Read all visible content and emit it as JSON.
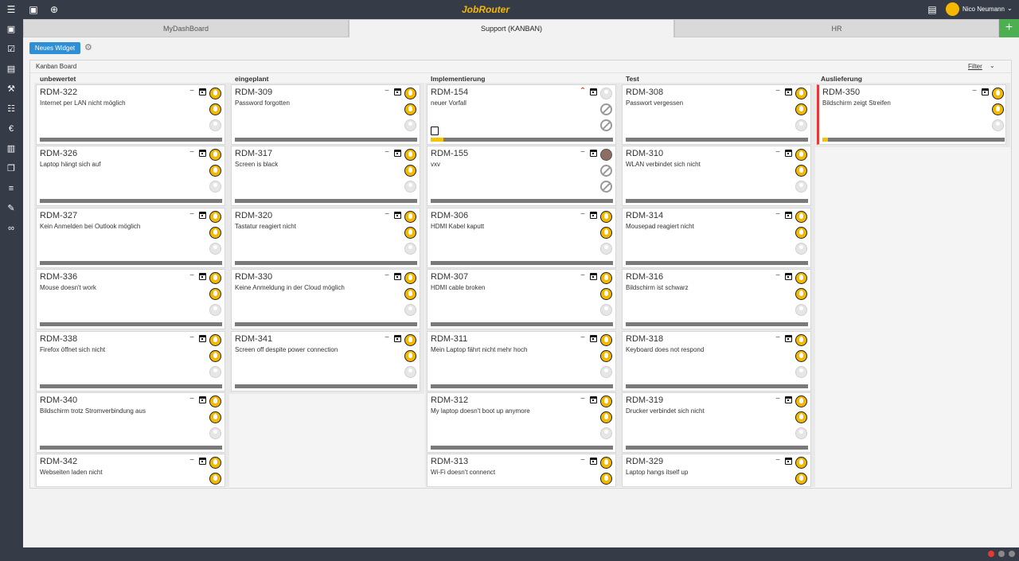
{
  "app": {
    "logo": "JobRouter",
    "user_name": "Nico Neumann"
  },
  "tabs": [
    {
      "label": "MyDashBoard",
      "active": false
    },
    {
      "label": "Support (KANBAN)",
      "active": true
    },
    {
      "label": "HR",
      "active": false
    }
  ],
  "toolbar": {
    "new_widget_label": "Neues Widget"
  },
  "board": {
    "title": "Kanban Board",
    "filter_label": "Filter"
  },
  "colors": {
    "chrome": "#363b48",
    "accent_yellow": "#f5b800",
    "button_blue": "#2f8fd6",
    "add_green": "#4caf50",
    "flag_red": "#e53935"
  },
  "columns": [
    {
      "title": "unbewertet",
      "cards": [
        {
          "id": "RDM-322",
          "desc": "Internet per LAN nicht möglich",
          "priority": "normal",
          "avatars": [
            "user",
            "user",
            "empty"
          ],
          "progress": 0
        },
        {
          "id": "RDM-326",
          "desc": "Laptop hängt sich auf",
          "priority": "normal",
          "avatars": [
            "user",
            "user",
            "empty"
          ],
          "progress": 0
        },
        {
          "id": "RDM-327",
          "desc": "Kein Anmelden bei Outlook möglich",
          "priority": "normal",
          "avatars": [
            "user",
            "user",
            "empty"
          ],
          "progress": 0
        },
        {
          "id": "RDM-336",
          "desc": "Mouse doesn't work",
          "priority": "normal",
          "avatars": [
            "user",
            "user",
            "empty"
          ],
          "progress": 0
        },
        {
          "id": "RDM-338",
          "desc": "Firefox öffnet sich nicht",
          "priority": "normal",
          "avatars": [
            "user",
            "user",
            "empty"
          ],
          "progress": 0
        },
        {
          "id": "RDM-340",
          "desc": "Bildschirm trotz Stromverbindung aus",
          "priority": "normal",
          "avatars": [
            "user",
            "user",
            "empty"
          ],
          "progress": 0
        },
        {
          "id": "RDM-342",
          "desc": "Webseiten laden nicht",
          "priority": "normal",
          "avatars": [
            "user",
            "user"
          ],
          "progress": 0
        }
      ]
    },
    {
      "title": "eingeplant",
      "cards": [
        {
          "id": "RDM-309",
          "desc": "Password forgotten",
          "priority": "normal",
          "avatars": [
            "user",
            "user",
            "empty"
          ],
          "progress": 0
        },
        {
          "id": "RDM-317",
          "desc": "Screen is black",
          "priority": "normal",
          "avatars": [
            "user",
            "user",
            "empty"
          ],
          "progress": 0
        },
        {
          "id": "RDM-320",
          "desc": "Tastatur reagiert nicht",
          "priority": "normal",
          "avatars": [
            "user",
            "user",
            "empty"
          ],
          "progress": 0
        },
        {
          "id": "RDM-330",
          "desc": "Keine Anmeldung in der Cloud möglich",
          "priority": "normal",
          "avatars": [
            "user",
            "user",
            "empty"
          ],
          "progress": 0
        },
        {
          "id": "RDM-341",
          "desc": "Screen off despite power connection",
          "priority": "normal",
          "avatars": [
            "user",
            "user",
            "empty"
          ],
          "progress": 0
        }
      ]
    },
    {
      "title": "Implementierung",
      "cards": [
        {
          "id": "RDM-154",
          "desc": "neuer Vorfall",
          "priority": "high",
          "avatars": [
            "empty",
            "blocked",
            "blocked"
          ],
          "progress": 0.07,
          "has_document": true
        },
        {
          "id": "RDM-155",
          "desc": "vxv",
          "priority": "normal",
          "avatars": [
            "photo",
            "blocked",
            "blocked"
          ],
          "progress": 0
        },
        {
          "id": "RDM-306",
          "desc": "HDMI Kabel kaputt",
          "priority": "normal",
          "avatars": [
            "user",
            "user",
            "empty"
          ],
          "progress": 0
        },
        {
          "id": "RDM-307",
          "desc": "HDMI cable broken",
          "priority": "normal",
          "avatars": [
            "user",
            "user",
            "empty"
          ],
          "progress": 0
        },
        {
          "id": "RDM-311",
          "desc": "Mein Laptop fährt nicht mehr hoch",
          "priority": "normal",
          "avatars": [
            "user",
            "user",
            "empty"
          ],
          "progress": 0
        },
        {
          "id": "RDM-312",
          "desc": "My laptop doesn't boot up anymore",
          "priority": "normal",
          "avatars": [
            "user",
            "user",
            "empty"
          ],
          "progress": 0
        },
        {
          "id": "RDM-313",
          "desc": "Wi-Fi doesn't connenct",
          "priority": "normal",
          "avatars": [
            "user",
            "user"
          ],
          "progress": 0
        }
      ]
    },
    {
      "title": "Test",
      "cards": [
        {
          "id": "RDM-308",
          "desc": "Passwort vergessen",
          "priority": "normal",
          "avatars": [
            "user",
            "user",
            "empty"
          ],
          "progress": 0
        },
        {
          "id": "RDM-310",
          "desc": "WLAN verbindet sich nicht",
          "priority": "normal",
          "avatars": [
            "user",
            "user",
            "empty"
          ],
          "progress": 0
        },
        {
          "id": "RDM-314",
          "desc": "Mousepad reagiert nicht",
          "priority": "normal",
          "avatars": [
            "user",
            "user",
            "empty"
          ],
          "progress": 0
        },
        {
          "id": "RDM-316",
          "desc": "Bildschirm ist schwarz",
          "priority": "normal",
          "avatars": [
            "user",
            "user",
            "empty"
          ],
          "progress": 0
        },
        {
          "id": "RDM-318",
          "desc": "Keyboard does not respond",
          "priority": "normal",
          "avatars": [
            "user",
            "user",
            "empty"
          ],
          "progress": 0
        },
        {
          "id": "RDM-319",
          "desc": "Drucker verbindet sich nicht",
          "priority": "normal",
          "avatars": [
            "user",
            "user",
            "empty"
          ],
          "progress": 0
        },
        {
          "id": "RDM-329",
          "desc": "Laptop hangs itself up",
          "priority": "normal",
          "avatars": [
            "user",
            "user"
          ],
          "progress": 0
        }
      ]
    },
    {
      "title": "Auslieferung",
      "cards": [
        {
          "id": "RDM-350",
          "desc": "Bildschirm zeigt Streifen",
          "priority": "normal",
          "avatars": [
            "user",
            "user",
            "empty"
          ],
          "progress": 0.03,
          "flagged": true
        }
      ]
    }
  ]
}
